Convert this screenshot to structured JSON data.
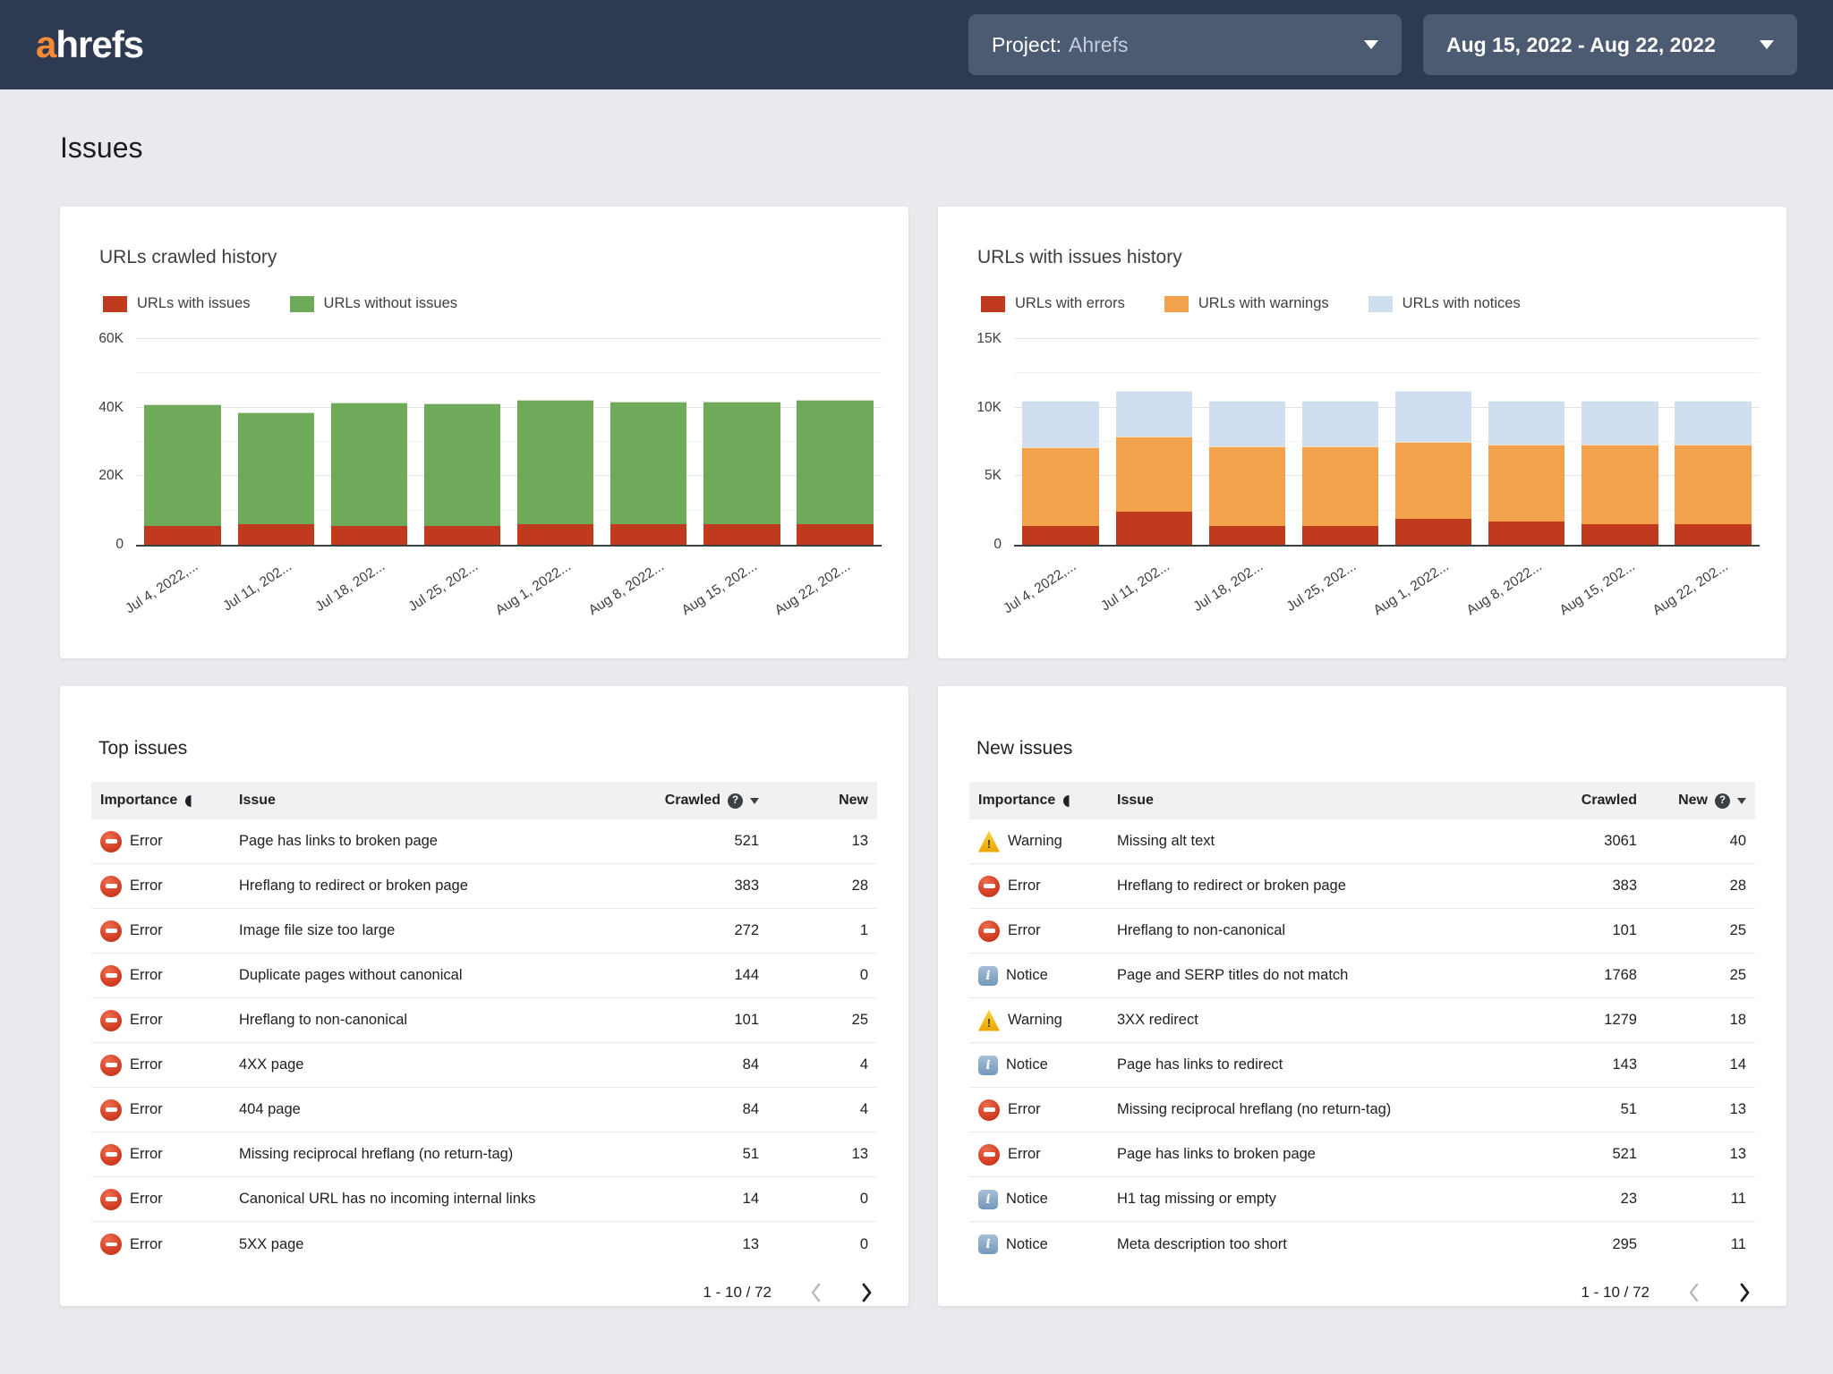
{
  "header": {
    "logo_a": "a",
    "logo_rest": "hrefs",
    "project_dropdown": {
      "label": "Project:",
      "value": "Ahrefs"
    },
    "date_dropdown": {
      "value": "Aug 15, 2022 - Aug 22, 2022"
    }
  },
  "page_title": "Issues",
  "icons": {
    "help_glyph": "?",
    "error_glyph": "",
    "warning_glyph": "!",
    "notice_glyph": "i"
  },
  "colors": {
    "topbar": "#2d3a52",
    "dropdown": "#4c5a72",
    "page_background": "#e9eaee",
    "accent_orange_logo": "#f78b35",
    "bar_red": "#c03b1e",
    "bar_green": "#6fa95a",
    "bar_orange": "#f2a14d",
    "bar_light_blue": "#cfdff0"
  },
  "chart_data": [
    {
      "type": "bar",
      "stacked": true,
      "title": "URLs crawled history",
      "categories": [
        "Jul 4, 2022,...",
        "Jul 11, 202...",
        "Jul 18, 202...",
        "Jul 25, 202...",
        "Aug 1, 2022...",
        "Aug 8, 2022...",
        "Aug 15, 202...",
        "Aug 22, 202..."
      ],
      "series": [
        {
          "name": "URLs with issues",
          "color": "#c03b1e",
          "values": [
            5400,
            5900,
            5500,
            5400,
            6100,
            6000,
            6000,
            6000
          ]
        },
        {
          "name": "URLs without issues",
          "color": "#6fa95a",
          "values": [
            35600,
            32600,
            36000,
            35900,
            36200,
            35800,
            35800,
            36200
          ]
        }
      ],
      "ylim": [
        0,
        60000
      ],
      "yticks": [
        0,
        20000,
        40000,
        60000
      ],
      "yminor": [
        10000,
        30000,
        50000
      ],
      "legend_position": "top",
      "grid": true
    },
    {
      "type": "bar",
      "stacked": true,
      "title": "URLs with issues history",
      "categories": [
        "Jul 4, 2022,...",
        "Jul 11, 202...",
        "Jul 18, 202...",
        "Jul 25, 202...",
        "Aug 1, 2022...",
        "Aug 8, 2022...",
        "Aug 15, 202...",
        "Aug 22, 202..."
      ],
      "series": [
        {
          "name": "URLs with errors",
          "color": "#c03b1e",
          "values": [
            1400,
            2400,
            1400,
            1400,
            1900,
            1700,
            1500,
            1500
          ]
        },
        {
          "name": "URLs with warnings",
          "color": "#f2a14d",
          "values": [
            5700,
            5500,
            5800,
            5800,
            5600,
            5600,
            5800,
            5800
          ]
        },
        {
          "name": "URLs with notices",
          "color": "#cfdff0",
          "values": [
            3400,
            3300,
            3300,
            3300,
            3700,
            3200,
            3200,
            3200
          ]
        }
      ],
      "ylim": [
        0,
        15000
      ],
      "yticks": [
        0,
        5000,
        10000,
        15000
      ],
      "yminor": [
        2500,
        7500,
        12500
      ],
      "legend_position": "top",
      "grid": true
    }
  ],
  "tables": {
    "top_issues": {
      "title": "Top issues",
      "columns": {
        "importance": "Importance",
        "issue": "Issue",
        "crawled": "Crawled",
        "new": "New"
      },
      "sorted_by": "crawled",
      "rows": [
        {
          "severity": "error",
          "label": "Error",
          "issue": "Page has links to broken page",
          "crawled": "521",
          "new": "13"
        },
        {
          "severity": "error",
          "label": "Error",
          "issue": "Hreflang to redirect or broken page",
          "crawled": "383",
          "new": "28"
        },
        {
          "severity": "error",
          "label": "Error",
          "issue": "Image file size too large",
          "crawled": "272",
          "new": "1"
        },
        {
          "severity": "error",
          "label": "Error",
          "issue": "Duplicate pages without canonical",
          "crawled": "144",
          "new": "0"
        },
        {
          "severity": "error",
          "label": "Error",
          "issue": "Hreflang to non-canonical",
          "crawled": "101",
          "new": "25"
        },
        {
          "severity": "error",
          "label": "Error",
          "issue": "4XX page",
          "crawled": "84",
          "new": "4"
        },
        {
          "severity": "error",
          "label": "Error",
          "issue": "404 page",
          "crawled": "84",
          "new": "4"
        },
        {
          "severity": "error",
          "label": "Error",
          "issue": "Missing reciprocal hreflang (no return-tag)",
          "crawled": "51",
          "new": "13"
        },
        {
          "severity": "error",
          "label": "Error",
          "issue": "Canonical URL has no incoming internal links",
          "crawled": "14",
          "new": "0"
        },
        {
          "severity": "error",
          "label": "Error",
          "issue": "5XX page",
          "crawled": "13",
          "new": "0"
        }
      ],
      "pagination": {
        "range": "1 - 10 / 72"
      }
    },
    "new_issues": {
      "title": "New issues",
      "columns": {
        "importance": "Importance",
        "issue": "Issue",
        "crawled": "Crawled",
        "new": "New"
      },
      "sorted_by": "new",
      "rows": [
        {
          "severity": "warning",
          "label": "Warning",
          "issue": "Missing alt text",
          "crawled": "3061",
          "new": "40"
        },
        {
          "severity": "error",
          "label": "Error",
          "issue": "Hreflang to redirect or broken page",
          "crawled": "383",
          "new": "28"
        },
        {
          "severity": "error",
          "label": "Error",
          "issue": "Hreflang to non-canonical",
          "crawled": "101",
          "new": "25"
        },
        {
          "severity": "notice",
          "label": "Notice",
          "issue": "Page and SERP titles do not match",
          "crawled": "1768",
          "new": "25"
        },
        {
          "severity": "warning",
          "label": "Warning",
          "issue": "3XX redirect",
          "crawled": "1279",
          "new": "18"
        },
        {
          "severity": "notice",
          "label": "Notice",
          "issue": "Page has links to redirect",
          "crawled": "143",
          "new": "14"
        },
        {
          "severity": "error",
          "label": "Error",
          "issue": "Missing reciprocal hreflang (no return-tag)",
          "crawled": "51",
          "new": "13"
        },
        {
          "severity": "error",
          "label": "Error",
          "issue": "Page has links to broken page",
          "crawled": "521",
          "new": "13"
        },
        {
          "severity": "notice",
          "label": "Notice",
          "issue": "H1 tag missing or empty",
          "crawled": "23",
          "new": "11"
        },
        {
          "severity": "notice",
          "label": "Notice",
          "issue": "Meta description too short",
          "crawled": "295",
          "new": "11"
        }
      ],
      "pagination": {
        "range": "1 - 10 / 72"
      }
    }
  }
}
